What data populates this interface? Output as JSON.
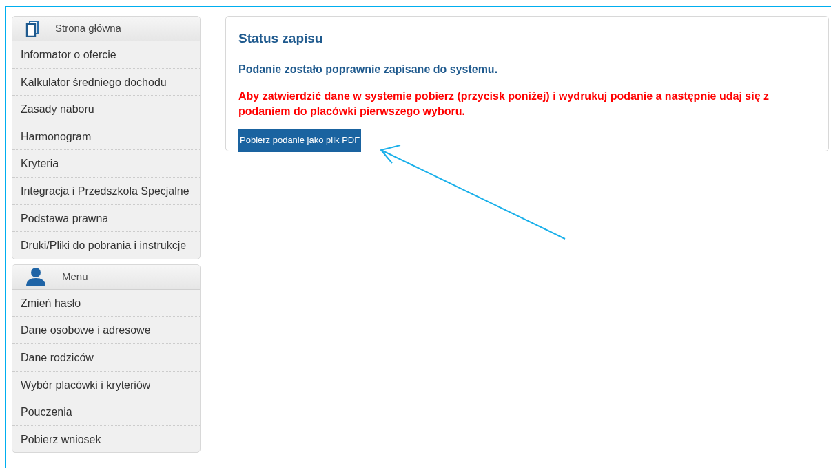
{
  "sidebar": [
    {
      "title": "Strona główna",
      "kind": "document",
      "items": [
        {
          "label": "Informator o ofercie"
        },
        {
          "label": "Kalkulator średniego dochodu"
        },
        {
          "label": "Zasady naboru"
        },
        {
          "label": "Harmonogram"
        },
        {
          "label": "Kryteria"
        },
        {
          "label": "Integracja i Przedszkola Specjalne"
        },
        {
          "label": "Podstawa prawna"
        },
        {
          "label": "Druki/Pliki do pobrania i instrukcje"
        }
      ]
    },
    {
      "title": "Menu",
      "kind": "user",
      "items": [
        {
          "label": "Zmień hasło"
        },
        {
          "label": "Dane osobowe i adresowe"
        },
        {
          "label": "Dane rodziców"
        },
        {
          "label": "Wybór placówki i kryteriów"
        },
        {
          "label": "Pouczenia"
        },
        {
          "label": "Pobierz wniosek"
        }
      ]
    }
  ],
  "status": {
    "title": "Status zapisu",
    "message": "Podanie zostało poprawnie zapisane do systemu.",
    "warning": "Aby zatwierdzić dane w systemie pobierz (przycisk poniżej) i wydrukuj podanie a następnie udaj się z podaniem do placówki pierwszego wyboru.",
    "button": "Pobierz podanie jako plik PDF"
  }
}
